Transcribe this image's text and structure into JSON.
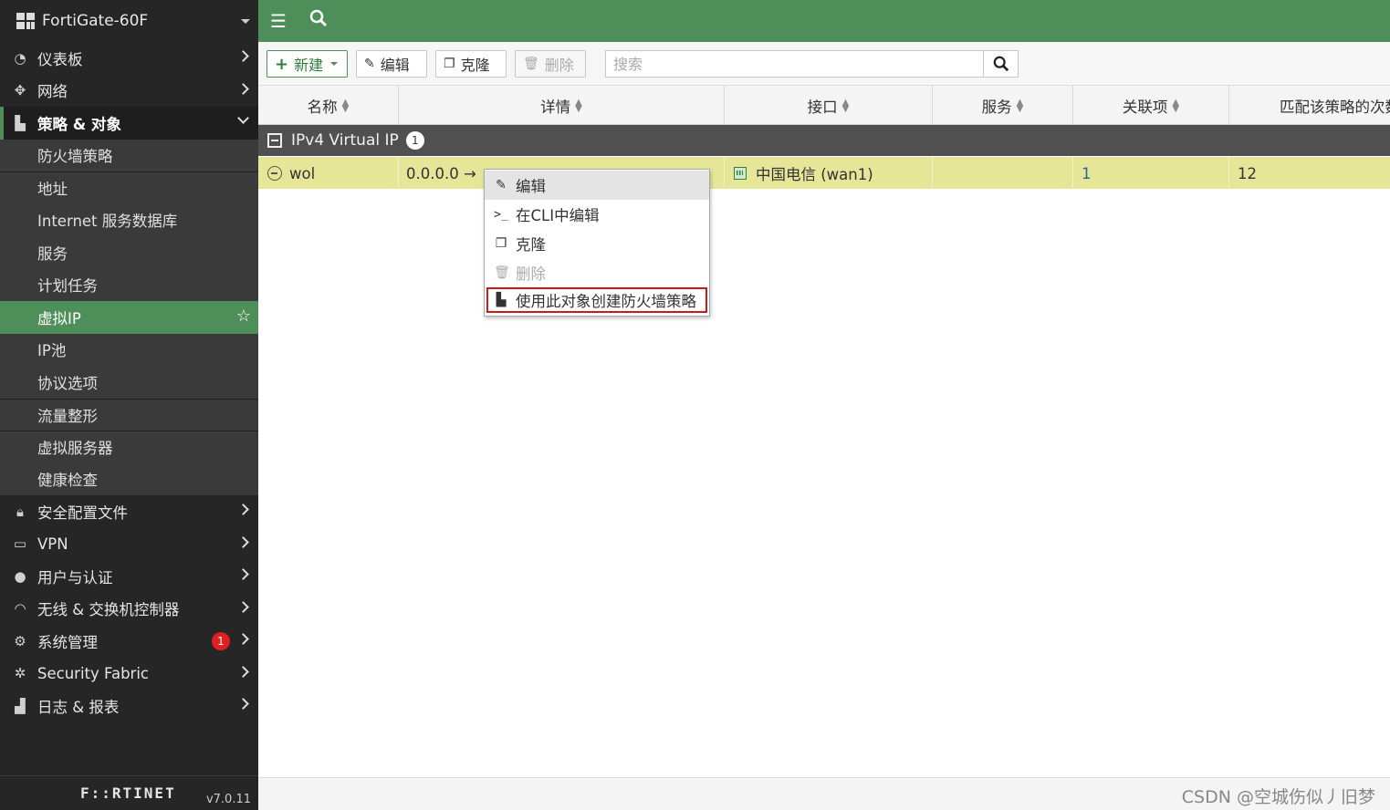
{
  "app": {
    "device_name": "FortiGate-60F",
    "brand": "F::RTINET",
    "version": "v7.0.11"
  },
  "sidebar": {
    "items": [
      {
        "label": "仪表板",
        "icon": "dashboard-icon"
      },
      {
        "label": "网络",
        "icon": "network-move-icon"
      },
      {
        "label": "策略 & 对象",
        "icon": "policy-icon",
        "expanded": true
      },
      {
        "label": "安全配置文件",
        "icon": "lock-icon"
      },
      {
        "label": "VPN",
        "icon": "laptop-icon"
      },
      {
        "label": "用户与认证",
        "icon": "user-icon"
      },
      {
        "label": "无线 & 交换机控制器",
        "icon": "wifi-icon"
      },
      {
        "label": "系统管理",
        "icon": "gear-icon",
        "badge": "1"
      },
      {
        "label": "Security Fabric",
        "icon": "fabric-icon"
      },
      {
        "label": "日志 & 报表",
        "icon": "chart-icon"
      }
    ],
    "subitems": [
      "防火墙策略",
      "地址",
      "Internet 服务数据库",
      "服务",
      "计划任务",
      "虚拟IP",
      "IP池",
      "协议选项",
      "流量整形",
      "虚拟服务器",
      "健康检查"
    ],
    "selected_sub": "虚拟IP"
  },
  "toolbar": {
    "new_label": "新建",
    "edit_label": "编辑",
    "clone_label": "克隆",
    "delete_label": "删除",
    "search_placeholder": "搜索"
  },
  "table": {
    "columns": [
      "名称",
      "详情",
      "接口",
      "服务",
      "关联项",
      "匹配该策略的次数"
    ],
    "group": {
      "label": "IPv4 Virtual IP",
      "count": "1"
    },
    "rows": [
      {
        "name": "wol",
        "details": "0.0.0.0 →",
        "interface": "中国电信 (wan1)",
        "service": "",
        "refs": "1",
        "hits": "12"
      }
    ]
  },
  "context_menu": {
    "items": [
      {
        "label": "编辑",
        "icon": "pencil-icon",
        "state": "hover"
      },
      {
        "label": "在CLI中编辑",
        "icon": "terminal-icon",
        "state": "normal"
      },
      {
        "label": "克隆",
        "icon": "clone-icon",
        "state": "normal"
      },
      {
        "label": "删除",
        "icon": "trash-icon",
        "state": "disabled"
      },
      {
        "label": "使用此对象创建防火墙策略",
        "icon": "policy-create-icon",
        "state": "highlighted"
      }
    ]
  },
  "watermark": "CSDN @空城伤似丿旧梦",
  "colors": {
    "accent_green": "#4e8f59",
    "sidebar_bg": "#262626",
    "row_highlight": "#e6e698",
    "badge_red": "#e02020",
    "menu_highlight_border": "#cc1a1a"
  }
}
